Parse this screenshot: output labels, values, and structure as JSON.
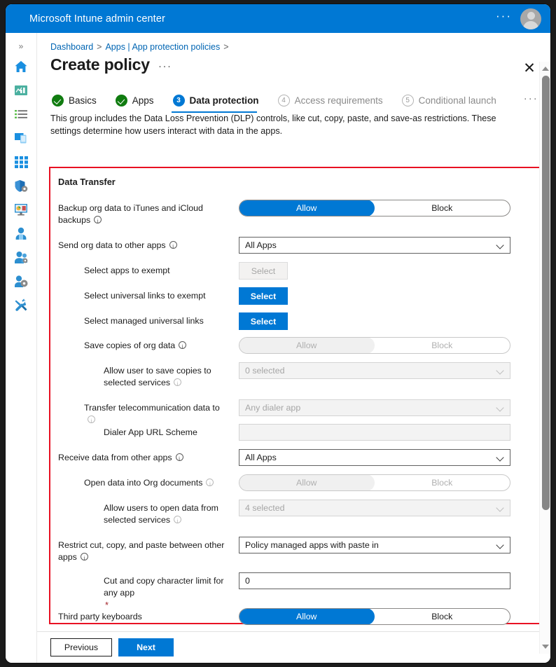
{
  "window": {
    "app_title": "Microsoft Intune admin center",
    "topbar_ellipsis": "···",
    "accent_color": "#0078d4",
    "highlight_color": "#e81123"
  },
  "rail": {
    "expand_label": "»",
    "items": [
      {
        "name": "home-icon",
        "label": "Home"
      },
      {
        "name": "dashboard-icon",
        "label": "Dashboard"
      },
      {
        "name": "all-services-icon",
        "label": "All services"
      },
      {
        "name": "devices-icon",
        "label": "Devices"
      },
      {
        "name": "apps-icon",
        "label": "Apps"
      },
      {
        "name": "endpoint-security-icon",
        "label": "Endpoint security"
      },
      {
        "name": "reports-icon",
        "label": "Reports"
      },
      {
        "name": "users-icon",
        "label": "Users"
      },
      {
        "name": "groups-icon",
        "label": "Groups"
      },
      {
        "name": "tenant-administration-icon",
        "label": "Tenant administration"
      },
      {
        "name": "troubleshooting-support-icon",
        "label": "Troubleshooting + support"
      }
    ]
  },
  "breadcrumb": {
    "items": [
      "Dashboard",
      "Apps | App protection policies"
    ],
    "separator": ">"
  },
  "header": {
    "title": "Create policy",
    "ellipsis": "···",
    "close": "✕"
  },
  "wizard": {
    "tabs": [
      {
        "state": "done",
        "badge": "✓",
        "label": "Basics"
      },
      {
        "state": "done",
        "badge": "✓",
        "label": "Apps"
      },
      {
        "state": "active",
        "badge": "3",
        "label": "Data protection"
      },
      {
        "state": "future",
        "badge": "4",
        "label": "Access requirements"
      },
      {
        "state": "future",
        "badge": "5",
        "label": "Conditional launch"
      }
    ],
    "ellipsis": "···",
    "intro": "This group includes the Data Loss Prevention (DLP) controls, like cut, copy, paste, and save-as restrictions. These settings determine how users interact with data in the apps."
  },
  "section": {
    "title": "Data Transfer"
  },
  "rows": {
    "backup_org_data": {
      "label": "Backup org data to iTunes and iCloud backups",
      "control": "toggle",
      "options": [
        "Allow",
        "Block"
      ],
      "value": "Allow",
      "disabled": false,
      "has_info": true,
      "indent": 0
    },
    "send_org_data": {
      "label": "Send org data to other apps",
      "control": "dropdown",
      "value": "All Apps",
      "disabled": false,
      "has_info": true,
      "indent": 0
    },
    "select_apps_exempt": {
      "label": "Select apps to exempt",
      "control": "button",
      "value": "Select",
      "disabled": true,
      "has_info": false,
      "indent": 1
    },
    "select_universal_links_exempt": {
      "label": "Select universal links to exempt",
      "control": "button",
      "value": "Select",
      "disabled": false,
      "has_info": false,
      "indent": 1
    },
    "select_managed_universal_links": {
      "label": "Select managed universal links",
      "control": "button",
      "value": "Select",
      "disabled": false,
      "has_info": false,
      "indent": 1
    },
    "save_copies": {
      "label": "Save copies of org data",
      "control": "toggle",
      "options": [
        "Allow",
        "Block"
      ],
      "value": "Allow",
      "disabled": true,
      "has_info": true,
      "indent": 1
    },
    "allow_save_selected_services": {
      "label": "Allow user to save copies to selected services",
      "control": "dropdown",
      "value": "0 selected",
      "disabled": true,
      "has_info": true,
      "indent": 2
    },
    "transfer_telecom": {
      "label": "Transfer telecommunication data to",
      "control": "dropdown",
      "value": "Any dialer app",
      "disabled": true,
      "has_info": true,
      "indent": 1
    },
    "dialer_url_scheme": {
      "label": "Dialer App URL Scheme",
      "control": "text",
      "value": "",
      "placeholder": "",
      "disabled": true,
      "has_info": false,
      "indent": 2
    },
    "receive_data": {
      "label": "Receive data from other apps",
      "control": "dropdown",
      "value": "All Apps",
      "disabled": false,
      "has_info": true,
      "indent": 0
    },
    "open_data_org_docs": {
      "label": "Open data into Org documents",
      "control": "toggle",
      "options": [
        "Allow",
        "Block"
      ],
      "value": "Allow",
      "disabled": true,
      "has_info": true,
      "indent": 1
    },
    "allow_open_selected_services": {
      "label": "Allow users to open data from selected services",
      "control": "dropdown",
      "value": "4 selected",
      "disabled": true,
      "has_info": true,
      "indent": 2
    },
    "restrict_cut_copy_paste": {
      "label": "Restrict cut, copy, and paste between other apps",
      "control": "dropdown",
      "value": "Policy managed apps with paste in",
      "disabled": false,
      "has_info": true,
      "indent": 0
    },
    "cut_copy_char_limit": {
      "label": "Cut and copy character limit for any app",
      "control": "text",
      "value": "0",
      "placeholder": "",
      "disabled": false,
      "has_info": false,
      "required": true,
      "required_mark": "*",
      "indent": 2
    },
    "third_party_keyboards": {
      "label": "Third party keyboards",
      "control": "toggle",
      "options": [
        "Allow",
        "Block"
      ],
      "value": "Allow",
      "disabled": false,
      "has_info": false,
      "indent": 0
    }
  },
  "footer": {
    "previous_label": "Previous",
    "next_label": "Next"
  },
  "scrollbar": {
    "up_arrow": "▲",
    "down_arrow": "▼"
  }
}
